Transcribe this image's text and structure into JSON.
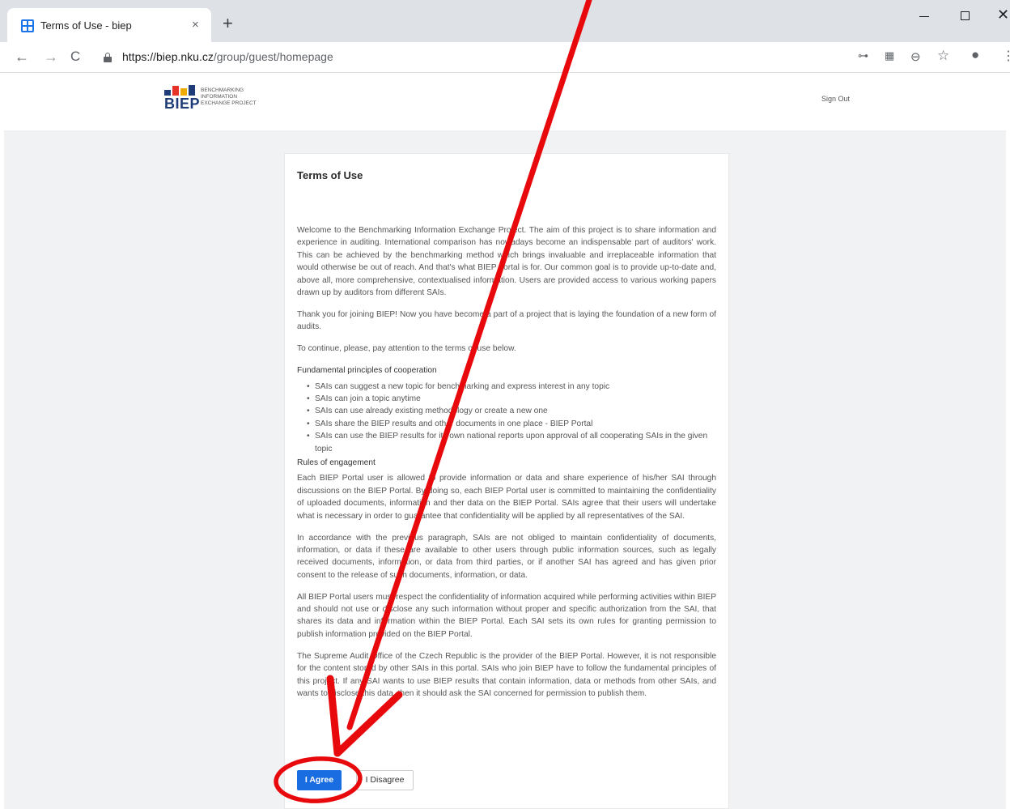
{
  "browser": {
    "tab_title": "Terms of Use - biep",
    "tab_close": "×",
    "new_tab": "+",
    "url_host": "https://biep.nku.cz",
    "url_path": "/group/guest/homepage",
    "icons": [
      "back-icon",
      "forward-icon",
      "reload-icon",
      "lock-icon",
      "key-icon",
      "translate-icon",
      "zoom-icon",
      "star-icon",
      "account-icon",
      "menu-icon"
    ]
  },
  "header": {
    "logo_word": "BIEP",
    "logo_sub": [
      "BENCHMARKING",
      "INFORMATION",
      "EXCHANGE PROJECT"
    ],
    "logo_colors": [
      "#1d3c78",
      "#e6332a",
      "#f2a900",
      "#1d3c78"
    ],
    "signout": "Sign Out"
  },
  "card": {
    "title": "Terms of Use",
    "intro": "Welcome to the Benchmarking Information Exchange Project. The aim of this project is to share information and experience in auditing. International comparison has nowadays become an indispensable part of auditors' work. This can be achieved by the benchmarking method which brings invaluable and irreplaceable information that would otherwise be out of reach. And that's what BIEP portal is for. Our common goal is to provide up-to-date and, above all, more comprehensive, contextualised information. Users are provided access to various working papers drawn up by auditors from different SAIs.",
    "thanks": "Thank you for joining BIEP! Now you have become a part of a project that is laying the foundation of a new form of audits.",
    "continue": "To continue, please, pay attention to the terms of use below.",
    "principles_heading": "Fundamental principles of cooperation",
    "principles": [
      "SAIs can suggest a new topic for benchmarking and express interest in any topic",
      "SAIs can join a topic anytime",
      "SAIs can use already existing methodology or create a new one",
      "SAIs share the BIEP results and other documents in one place - BIEP Portal",
      "SAIs can use the BIEP results for its own national reports upon approval of all cooperating SAIs in the given topic"
    ],
    "rules_heading": "Rules of engagement",
    "rules": [
      "Each BIEP Portal user is allowed to provide information or data and share experience of his/her SAI through discussions on the BIEP Portal. By doing so, each BIEP Portal user is committed to maintaining the confidentiality of uploaded documents, information and ther data on the BIEP Portal. SAIs agree that their users will undertake what is necessary in order to guarantee that confidentiality will be applied by all representatives of the SAI.",
      "In accordance with the previous paragraph, SAIs are not obliged to maintain confidentiality of documents, information, or data if these are available to other users through public information sources, such as legally received documents, information, or data from third parties, or if another SAI has agreed and has given prior consent to the release of such documents, information, or data.",
      "All BIEP Portal users must respect the confidentiality of information acquired while performing activities within BIEP and should not use or disclose any such information without proper and specific authorization from the SAI, that shares its data and information within the BIEP Portal. Each SAI sets its own rules for granting permission to publish information provided on the BIEP Portal.",
      "The Supreme Audit Office of the Czech Republic is the provider of the BIEP Portal. However, it is not responsible for the content stored by other SAIs in this portal. SAIs who join BIEP  have to follow the fundamental principles of this project. If any SAI wants to use BIEP results that contain information, data or methods from other SAIs, and wants to disclose this data, then it should ask the SAI concerned for permission to publish them."
    ],
    "agree_label": "I Agree",
    "disagree_label": "I Disagree"
  },
  "annotation": {
    "color": "#e8090d"
  }
}
